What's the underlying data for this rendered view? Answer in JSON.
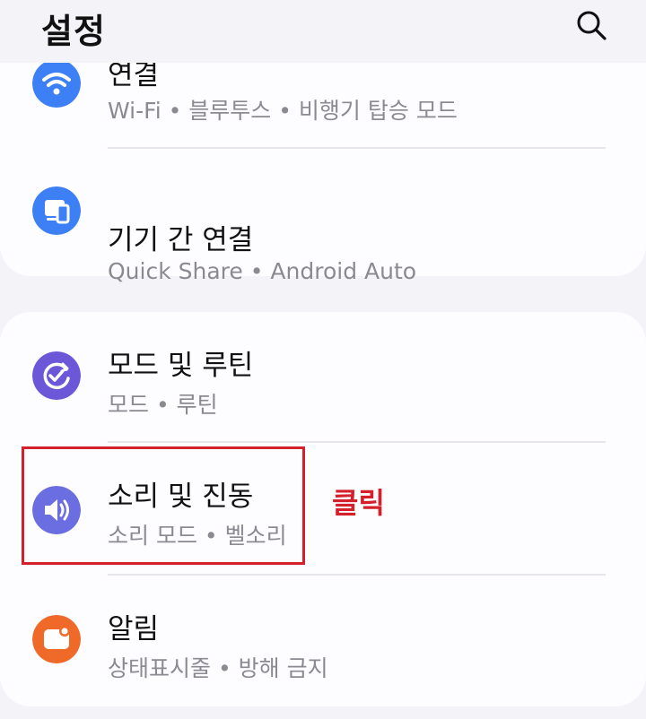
{
  "header": {
    "title": "설정",
    "search_icon": "search-icon"
  },
  "items": [
    {
      "id": "connections",
      "title": "연결",
      "subtitle": "Wi-Fi • 블루투스 • 비행기 탑승 모드",
      "icon": "wifi-icon",
      "icon_color": "#3d7ff5"
    },
    {
      "id": "connected-devices",
      "title": "기기 간 연결",
      "subtitle": "Quick Share • Android Auto",
      "icon": "devices-icon",
      "icon_color": "#3d7ff5"
    },
    {
      "id": "modes-routines",
      "title": "모드 및 루틴",
      "subtitle": "모드 • 루틴",
      "icon": "routine-check-icon",
      "icon_color": "#6b57d8"
    },
    {
      "id": "sound-vibration",
      "title": "소리 및 진동",
      "subtitle": "소리 모드 • 벨소리",
      "icon": "speaker-icon",
      "icon_color": "#6b6ee0"
    },
    {
      "id": "notifications",
      "title": "알림",
      "subtitle": "상태표시줄 • 방해 금지",
      "icon": "notification-icon",
      "icon_color": "#ef6a28"
    }
  ],
  "annotation": {
    "label": "클릭",
    "color": "#d4202b"
  }
}
